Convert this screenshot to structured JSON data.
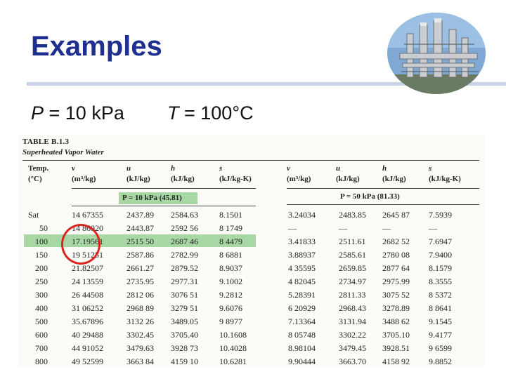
{
  "slide": {
    "title": "Examples",
    "pressure_label": "P",
    "pressure_rest": " = 10 kPa",
    "temperature_label": "T",
    "temperature_rest": " = 100°C"
  },
  "table": {
    "label": "TABLE B.1.3",
    "subtitle": "Superheated Vapor Water",
    "temp_header": [
      "Temp.",
      "(°C)"
    ],
    "col_headers_left": [
      [
        "v",
        "(m³/kg)"
      ],
      [
        "u",
        "(kJ/kg)"
      ],
      [
        "h",
        "(kJ/kg)"
      ],
      [
        "s",
        "(kJ/kg-K)"
      ]
    ],
    "col_headers_right": [
      [
        "v",
        "(m³/kg)"
      ],
      [
        "u",
        "(kJ/kg)"
      ],
      [
        "h",
        "(kJ/kg)"
      ],
      [
        "s",
        "(kJ/kg-K)"
      ]
    ],
    "left_pressure": "P = 10 kPa (45.81)",
    "right_pressure": "P = 50 kPa (81.33)",
    "rows": [
      {
        "t": "Sat",
        "l": [
          "14 67355",
          "2437.89",
          "2584.63",
          "8.1501"
        ],
        "r": [
          "3.24034",
          "2483.85",
          "2645 87",
          "7.5939"
        ]
      },
      {
        "t": "50",
        "l": [
          "14 86920",
          "2443.87",
          "2592 56",
          "8 1749"
        ],
        "r": [
          "—",
          "—",
          "—",
          "—"
        ]
      },
      {
        "t": "100",
        "l": [
          "17.19561",
          "2515 50",
          "2687 46",
          "8 4479"
        ],
        "r": [
          "3.41833",
          "2511.61",
          "2682 52",
          "7.6947"
        ]
      },
      {
        "t": "150",
        "l": [
          "19 51251",
          "2587.86",
          "2782.99",
          "8 6881"
        ],
        "r": [
          "3.88937",
          "2585.61",
          "2780 08",
          "7.9400"
        ]
      },
      {
        "t": "200",
        "l": [
          "21.82507",
          "2661.27",
          "2879.52",
          "8.9037"
        ],
        "r": [
          "4 35595",
          "2659.85",
          "2877 64",
          "8.1579"
        ]
      },
      {
        "t": "250",
        "l": [
          "24 13559",
          "2735.95",
          "2977.31",
          "9.1002"
        ],
        "r": [
          "4 82045",
          "2734.97",
          "2975.99",
          "8.3555"
        ]
      },
      {
        "t": "300",
        "l": [
          "26 44508",
          "2812 06",
          "3076 51",
          "9.2812"
        ],
        "r": [
          "5.28391",
          "2811.33",
          "3075 52",
          "8 5372"
        ]
      },
      {
        "t": "400",
        "l": [
          "31 06252",
          "2968 89",
          "3279 51",
          "9.6076"
        ],
        "r": [
          "6 20929",
          "2968.43",
          "3278.89",
          "8 8641"
        ]
      },
      {
        "t": "500",
        "l": [
          "35.67896",
          "3132 26",
          "3489.05",
          "9 8977"
        ],
        "r": [
          "7.13364",
          "3131.94",
          "3488 62",
          "9.1545"
        ]
      },
      {
        "t": "600",
        "l": [
          "40 29488",
          "3302.45",
          "3705.40",
          "10.1608"
        ],
        "r": [
          "8 05748",
          "3302.22",
          "3705.10",
          "9.4177"
        ]
      },
      {
        "t": "700",
        "l": [
          "44 91052",
          "3479.63",
          "3928 73",
          "10.4028"
        ],
        "r": [
          "8.98104",
          "3479.45",
          "3928.51",
          "9 6599"
        ]
      },
      {
        "t": "800",
        "l": [
          "49 52599",
          "3663 84",
          "4159 10",
          "10.6281"
        ],
        "r": [
          "9.90444",
          "3663.70",
          "4158 92",
          "9.8852"
        ]
      }
    ]
  },
  "colors": {
    "title": "#1f2f8f",
    "highlight": "#a7d8a4",
    "circle": "#d8261e"
  }
}
